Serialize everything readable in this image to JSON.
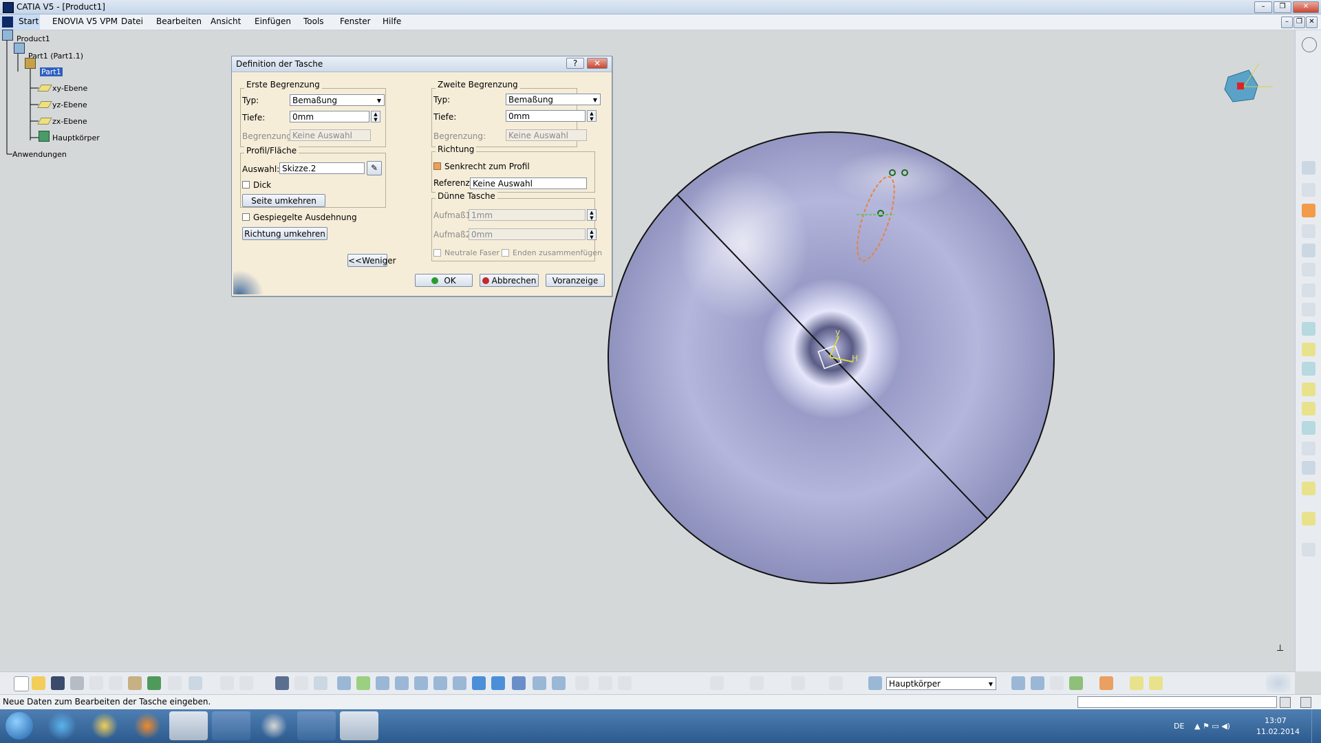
{
  "window": {
    "title": "CATIA V5 - [Product1]"
  },
  "menu": [
    "Start",
    "ENOVIA V5 VPM",
    "Datei",
    "Bearbeiten",
    "Ansicht",
    "Einfügen",
    "Tools",
    "Fenster",
    "Hilfe"
  ],
  "tree": {
    "root": "Product1",
    "part_instance": "Part1 (Part1.1)",
    "part": "Part1",
    "planes": [
      "xy-Ebene",
      "yz-Ebene",
      "zx-Ebene"
    ],
    "body": "Hauptkörper",
    "apps": "Anwendungen"
  },
  "dialog": {
    "title": "Definition der Tasche",
    "help": "?",
    "close": "✕",
    "first_limit": {
      "label": "Erste Begrenzung",
      "type_label": "Typ:",
      "type_value": "Bemaßung",
      "depth_label": "Tiefe:",
      "depth_value": "0mm",
      "limit_label": "Begrenzung:",
      "limit_value": "Keine Auswahl"
    },
    "profile": {
      "label": "Profil/Fläche",
      "selection_label": "Auswahl:",
      "selection_value": "Skizze.2",
      "thick_label": "Dick",
      "reverse_side": "Seite umkehren"
    },
    "mirrored": "Gespiegelte Ausdehnung",
    "reverse_direction": "Richtung umkehren",
    "less": "<<Weniger",
    "second_limit": {
      "label": "Zweite Begrenzung",
      "type_label": "Typ:",
      "type_value": "Bemaßung",
      "depth_label": "Tiefe:",
      "depth_value": "0mm",
      "limit_label": "Begrenzung:",
      "limit_value": "Keine Auswahl"
    },
    "direction": {
      "label": "Richtung",
      "normal_label": "Senkrecht zum Profil",
      "reference_label": "Referenz:",
      "reference_value": "Keine Auswahl"
    },
    "thin": {
      "label": "Dünne Tasche",
      "thickness1_label": "Aufmaß1",
      "thickness1_value": "1mm",
      "thickness2_label": "Aufmaß2:",
      "thickness2_value": "0mm",
      "neutral_label": "Neutrale Faser",
      "merge_label": "Enden zusammenfügen"
    },
    "ok": "OK",
    "cancel": "Abbrechen",
    "preview": "Voranzeige"
  },
  "viewport": {
    "axis_labels": [
      "y",
      "H"
    ],
    "body_color": "#b4b6dc"
  },
  "toolbar": {
    "body_select": "Hauptkörper"
  },
  "status": {
    "message": "Neue Daten zum Bearbeiten der Tasche eingeben."
  },
  "taskbar": {
    "lang": "DE",
    "time": "13:07",
    "date": "11.02.2014"
  }
}
